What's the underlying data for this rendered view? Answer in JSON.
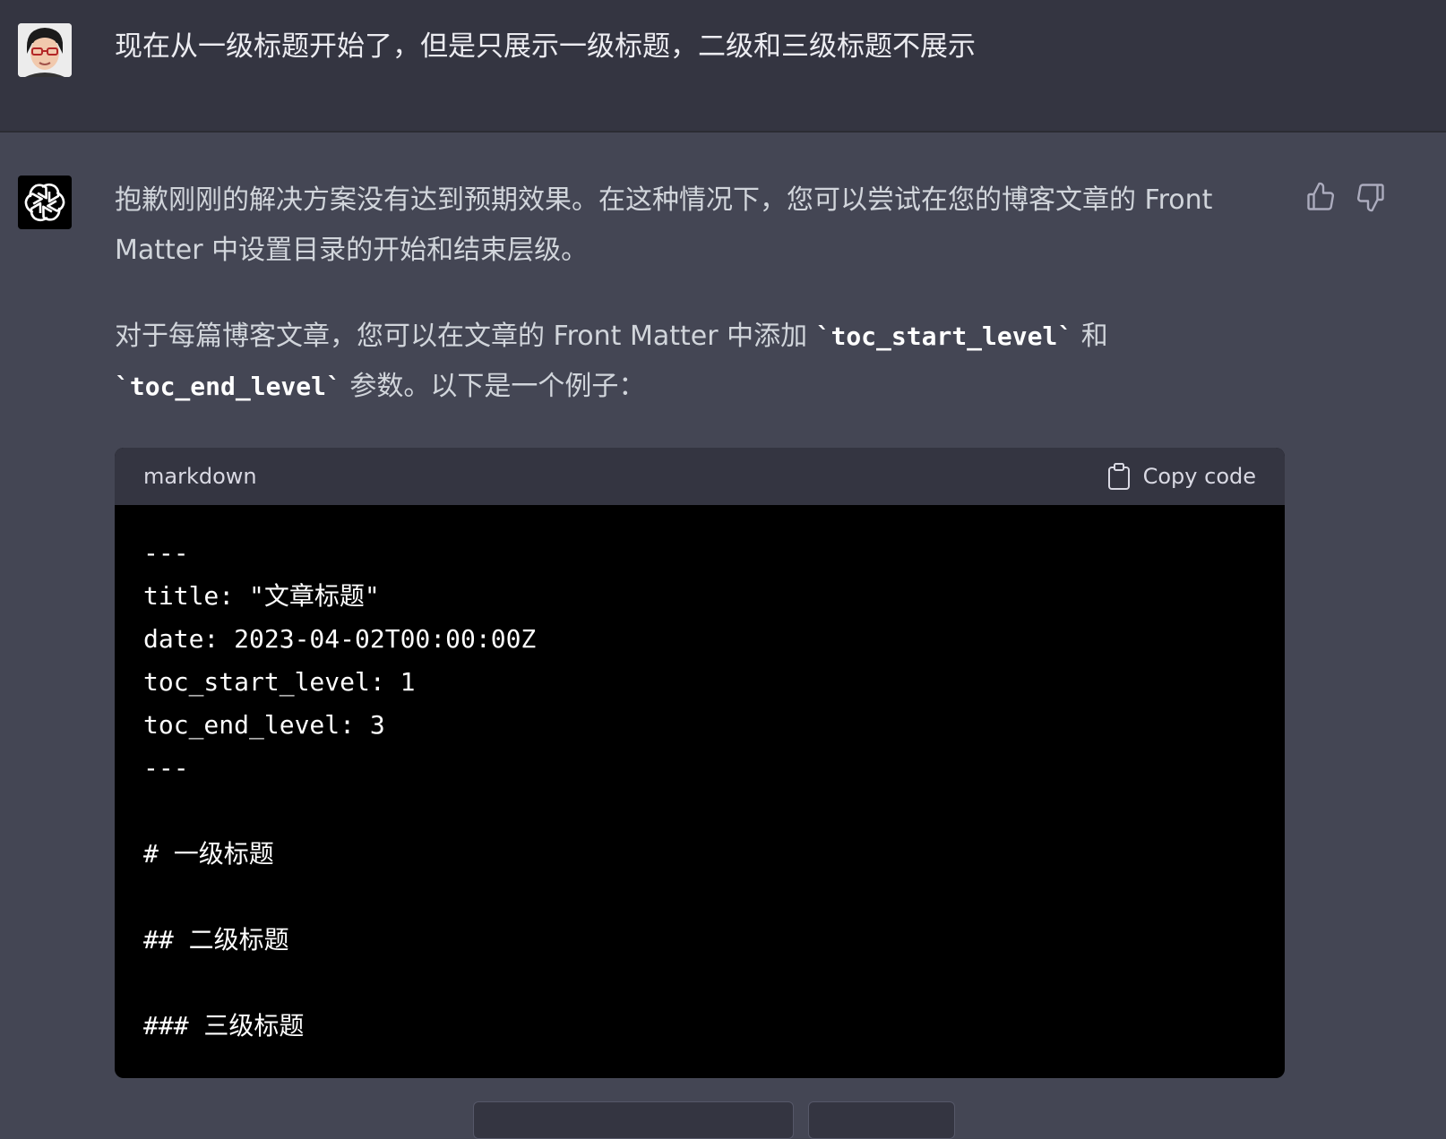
{
  "user": {
    "message": "现在从一级标题开始了，但是只展示一级标题，二级和三级标题不展示"
  },
  "assistant": {
    "paragraph1": "抱歉刚刚的解决方案没有达到预期效果。在这种情况下，您可以尝试在您的博客文章的 Front Matter 中设置目录的开始和结束层级。",
    "paragraph2": {
      "text_a": "对于每篇博客文章，您可以在文章的 Front Matter 中添加 ",
      "code_a": "`toc_start_level`",
      "text_b": " 和 ",
      "code_b": "`toc_end_level`",
      "text_c": " 参数。以下是一个例子："
    },
    "code_block": {
      "language": "markdown",
      "copy_label": "Copy code",
      "lines": [
        "---",
        "title: \"文章标题\"",
        "date: 2023-04-02T00:00:00Z",
        "toc_start_level: 1",
        "toc_end_level: 3",
        "---",
        "",
        "# 一级标题",
        "",
        "## 二级标题",
        "",
        "### 三级标题"
      ]
    },
    "icons": {
      "thumbs_up": "thumbs-up-icon",
      "thumbs_down": "thumbs-down-icon",
      "copy": "clipboard-icon",
      "logo": "openai-logo-icon"
    }
  },
  "colors": {
    "user_bg": "#343541",
    "assistant_bg": "#444654",
    "code_bg": "#000000",
    "code_header_bg": "#343541",
    "text": "#d1d5db"
  }
}
